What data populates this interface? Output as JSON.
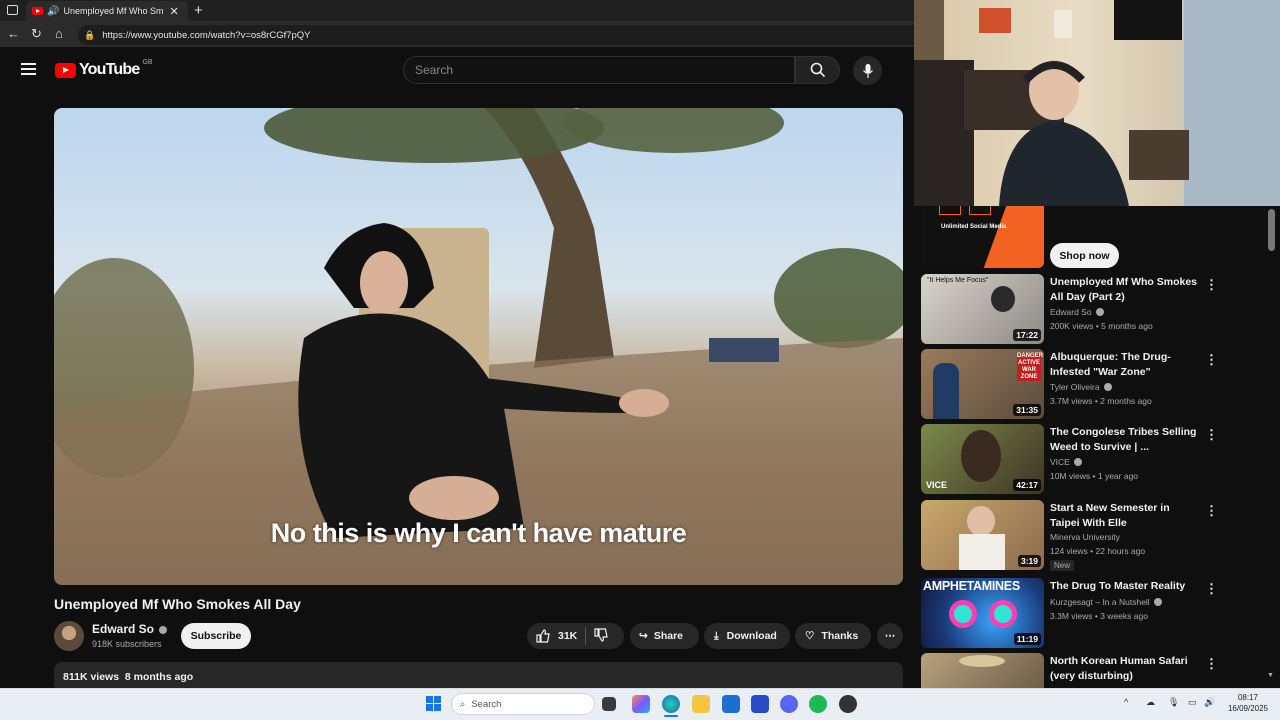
{
  "browser": {
    "tab_title": "Unemployed Mf Who Smok",
    "tab_close": "✕",
    "new_tab": "+",
    "url": "https://www.youtube.com/watch?v=os8rCGf7pQY"
  },
  "youtube": {
    "logo_text": "YouTube",
    "region": "GB",
    "search_placeholder": "Search"
  },
  "video": {
    "caption": "No this is why I can't have mature",
    "title": "Unemployed Mf Who Smokes All Day",
    "channel": "Edward So",
    "subscribers": "918K subscribers",
    "subscribe_label": "Subscribe",
    "likes": "31K",
    "share_label": "Share",
    "download_label": "Download",
    "thanks_label": "Thanks",
    "views": "811K views",
    "age": "8 months ago"
  },
  "sidebar": {
    "ad_text": "Unlimited Social Media",
    "shop_now": "Shop now",
    "recommendations": [
      {
        "title": "Unemployed Mf Who Smokes All Day (Part 2)",
        "channel": "Edward So",
        "verified": true,
        "meta": "200K views • 5 months ago",
        "duration": "17:22",
        "thumb_text": "\"It Helps Me Focus\""
      },
      {
        "title": "Albuquerque: The Drug-Infested \"War Zone\"",
        "channel": "Tyler Oliveira",
        "verified": true,
        "meta": "3.7M views • 2 months ago",
        "duration": "31:35",
        "thumb_text": "DANGER ACTIVE WAR ZONE"
      },
      {
        "title": "The Congolese Tribes Selling Weed to Survive | ...",
        "channel": "VICE",
        "verified": true,
        "meta": "10M views • 1 year ago",
        "duration": "42:17",
        "thumb_text": "VICE"
      },
      {
        "title": "Start a New Semester in Taipei With Elle",
        "channel": "Minerva University",
        "verified": false,
        "meta": "124 views • 22 hours ago",
        "duration": "3:19",
        "badge": "New"
      },
      {
        "title": "The Drug To Master Reality",
        "channel": "Kurzgesagt – In a Nutshell",
        "verified": true,
        "meta": "3.3M views • 3 weeks ago",
        "duration": "11:19",
        "thumb_text": "AMPHETAMINES"
      },
      {
        "title": "North Korean Human Safari (very disturbing)",
        "channel": "",
        "verified": false,
        "meta": "",
        "duration": ""
      }
    ]
  },
  "taskbar": {
    "search_placeholder": "Search",
    "time": "08:17",
    "date": "16/09/2025"
  }
}
